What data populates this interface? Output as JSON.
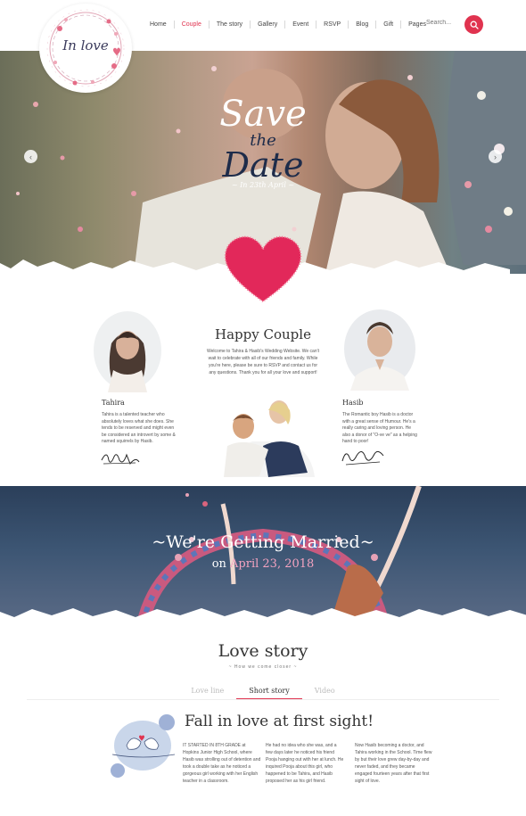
{
  "logo": {
    "text": "In love"
  },
  "nav": {
    "items": [
      "Home",
      "Couple",
      "The story",
      "Gallery",
      "Event",
      "RSVP",
      "Blog",
      "Gift",
      "Pages"
    ],
    "active_index": 1,
    "search_placeholder": "Search...",
    "accent": "#e0334f"
  },
  "hero": {
    "line1": "Save",
    "line2": "the",
    "line3": "Date",
    "date": "~ In 23th April ~"
  },
  "couple": {
    "title": "Happy Couple",
    "intro": "Welcome to Tahira & Hasib's Wedding Website. We can't wait to celebrate with all of our friends and family. While you're here, please be sure to RSVP and contact us for any questions. Thank you for all your love and support!",
    "bride": {
      "name": "Tahira",
      "bio": "Tahira is a talented teacher who absolutely loves what she does. She tends to be reserved and might even be considered an introvert by some & named squirrels by Hasib."
    },
    "groom": {
      "name": "Hasib",
      "bio": "The Romantic boy Hasib is a doctor with a great sense of Humour. He's a really caring and loving person. He also a donor of \"O-ve ve\" as a helping hand to poor!"
    }
  },
  "banner": {
    "title": "~We're Getting Married~",
    "date_prefix": "on ",
    "date_highlight": "April 23, 2018",
    "highlight_color": "#f4a3c0"
  },
  "love_story": {
    "title": "Love story",
    "subtitle": "~ How we come closer ~",
    "tabs": [
      "Love line",
      "Short story",
      "Video"
    ],
    "active_tab": 1,
    "heading": "Fall in love at first sight!",
    "columns": [
      "IT STARTED IN 8TH GRADE at Hopkins Junior High School, where Hasib was strolling out of detention and took a double take as he noticed a gorgeous girl working with her English teacher in a classroom.",
      "He had no idea who she was, and a few days later he noticed his friend Pooja hanging out with her at lunch. He inquired Pooja about this girl, who happened to be Tahira, and Hasib proposed her as his girl friend.",
      "Now Hasib becoming a doctor, and Tahira working in the School. Time flew by but their love grew day-by-day and never faded, and they became engaged fourteen years after that first sight of love."
    ]
  }
}
